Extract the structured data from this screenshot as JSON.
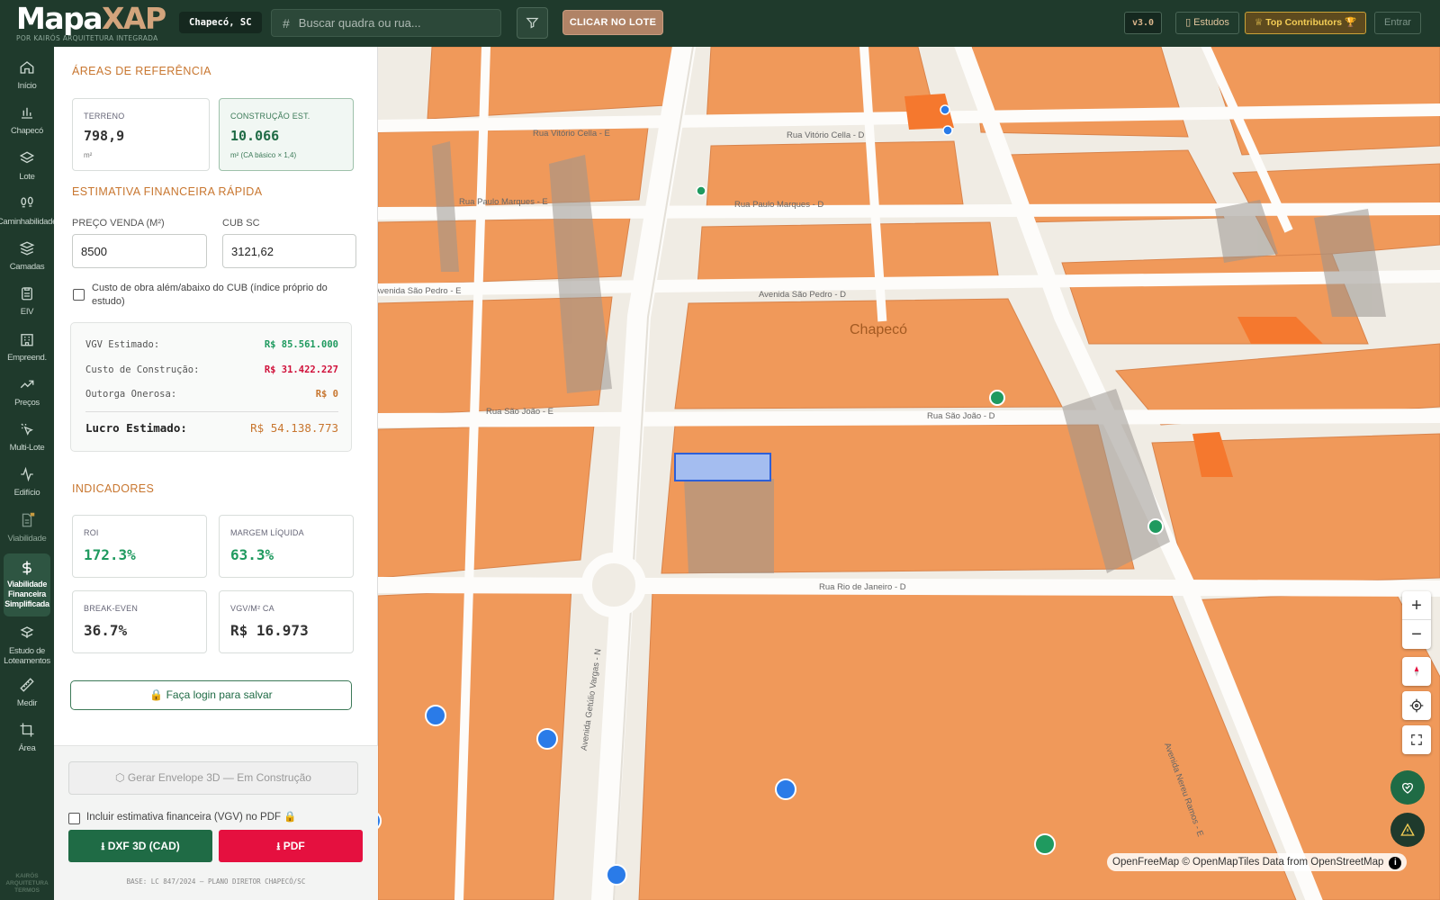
{
  "app": {
    "logo_main": "Mapa",
    "logo_accent": "XAP",
    "logo_sub": "POR KAIRÓS ARQUITETURA INTEGRADA",
    "city_badge": "Chapecó, SC",
    "search_placeholder": "Buscar quadra ou rua...",
    "clicar_lote": "CLICAR NO LOTE",
    "version": "v3.0",
    "estudos": "Estudos",
    "top_contributors": "Top Contributors 🏆",
    "entrar": "Entrar"
  },
  "nav": [
    {
      "label": "Início",
      "icon": "home-icon"
    },
    {
      "label": "Chapecó",
      "icon": "bar-chart-icon"
    },
    {
      "label": "Lote",
      "icon": "layers-icon"
    },
    {
      "label": "Caminhabilidade",
      "icon": "footprints-icon"
    },
    {
      "label": "Camadas",
      "icon": "stack-icon"
    },
    {
      "label": "EIV",
      "icon": "clipboard-icon"
    },
    {
      "label": "Empreend.",
      "icon": "building-icon"
    },
    {
      "label": "Preços",
      "icon": "trend-up-icon"
    },
    {
      "label": "Multi-Lote",
      "icon": "pointer-icon"
    },
    {
      "label": "Edifício",
      "icon": "activity-icon"
    },
    {
      "label": "Viabilidade",
      "icon": "locked-document-icon"
    },
    {
      "label": "Viabilidade Financeira Simplificada",
      "icon": "dollar-icon"
    },
    {
      "label": "Estudo de Loteamentos",
      "icon": "subdivision-icon"
    },
    {
      "label": "Medir",
      "icon": "ruler-icon"
    },
    {
      "label": "Área",
      "icon": "crop-icon"
    }
  ],
  "nav_footer": "KAIRÓS ARQUITETURA TERMOS",
  "panel": {
    "ref_title": "ÁREAS DE REFERÊNCIA",
    "terreno_label": "TERRENO",
    "terreno_value": "798,9",
    "terreno_unit": "m²",
    "construcao_label": "CONSTRUÇÃO EST.",
    "construcao_value": "10.066",
    "construcao_unit": "m² (CA básico × 1,4)",
    "fin_title": "ESTIMATIVA FINANCEIRA RÁPIDA",
    "preco_label": "PREÇO VENDA (M²)",
    "preco_value": "8500",
    "cub_label": "CUB SC",
    "cub_value": "3121,62",
    "custo_check_label": "Custo de obra além/abaixo do CUB (índice próprio do estudo)",
    "summary": {
      "vgv_label": "VGV Estimado:",
      "vgv_value": "R$ 85.561.000",
      "custo_label": "Custo de Construção:",
      "custo_value": "R$ 31.422.227",
      "outorga_label": "Outorga Onerosa:",
      "outorga_value": "R$ 0",
      "lucro_label": "Lucro Estimado:",
      "lucro_value": "R$ 54.138.773"
    },
    "ind_title": "INDICADORES",
    "roi_label": "ROI",
    "roi_value": "172.3%",
    "margem_label": "MARGEM LÍQUIDA",
    "margem_value": "63.3%",
    "breakeven_label": "BREAK-EVEN",
    "breakeven_value": "36.7%",
    "vgvm2_label": "VGV/M² CA",
    "vgvm2_value": "R$ 16.973",
    "login_button": "🔒 Faça login para salvar",
    "envelope_button": "⬡ Gerar Envelope 3D — Em Construção",
    "incluir_label": "Incluir estimativa financeira (VGV) no PDF 🔒",
    "dxf_button": "⭳ DXF 3D (CAD)",
    "pdf_button": "⭳ PDF",
    "base_note": "BASE: LC 847/2024 — PLANO DIRETOR CHAPECÓ/SC"
  },
  "map": {
    "city_label": "Chapecó",
    "streets": [
      "Rua Vitório Cella - E",
      "Rua Vitório Cella - D",
      "Rua Paulo Marques - E",
      "Rua Paulo Marques - D",
      "Avenida São Pedro - E",
      "Avenida São Pedro - D",
      "Rua São João - E",
      "Rua São João - D",
      "Rua Rio de Janeiro - D",
      "Avenida Getúlio Vargas - N",
      "Avenida Nereu Ramos - E"
    ],
    "attribution": "OpenFreeMap © OpenMapTiles Data from OpenStreetMap",
    "zoom_in": "+",
    "zoom_out": "−"
  },
  "colors": {
    "header_bg": "#1f3a2c",
    "accent_orange": "#c8762f",
    "building": "#f0995a",
    "selected_lot": "#a4bdf0",
    "green_value": "#1f9a5f",
    "red_value": "#d0103a",
    "pdf_red": "#e5103f",
    "dxf_green": "#1f6b45"
  }
}
